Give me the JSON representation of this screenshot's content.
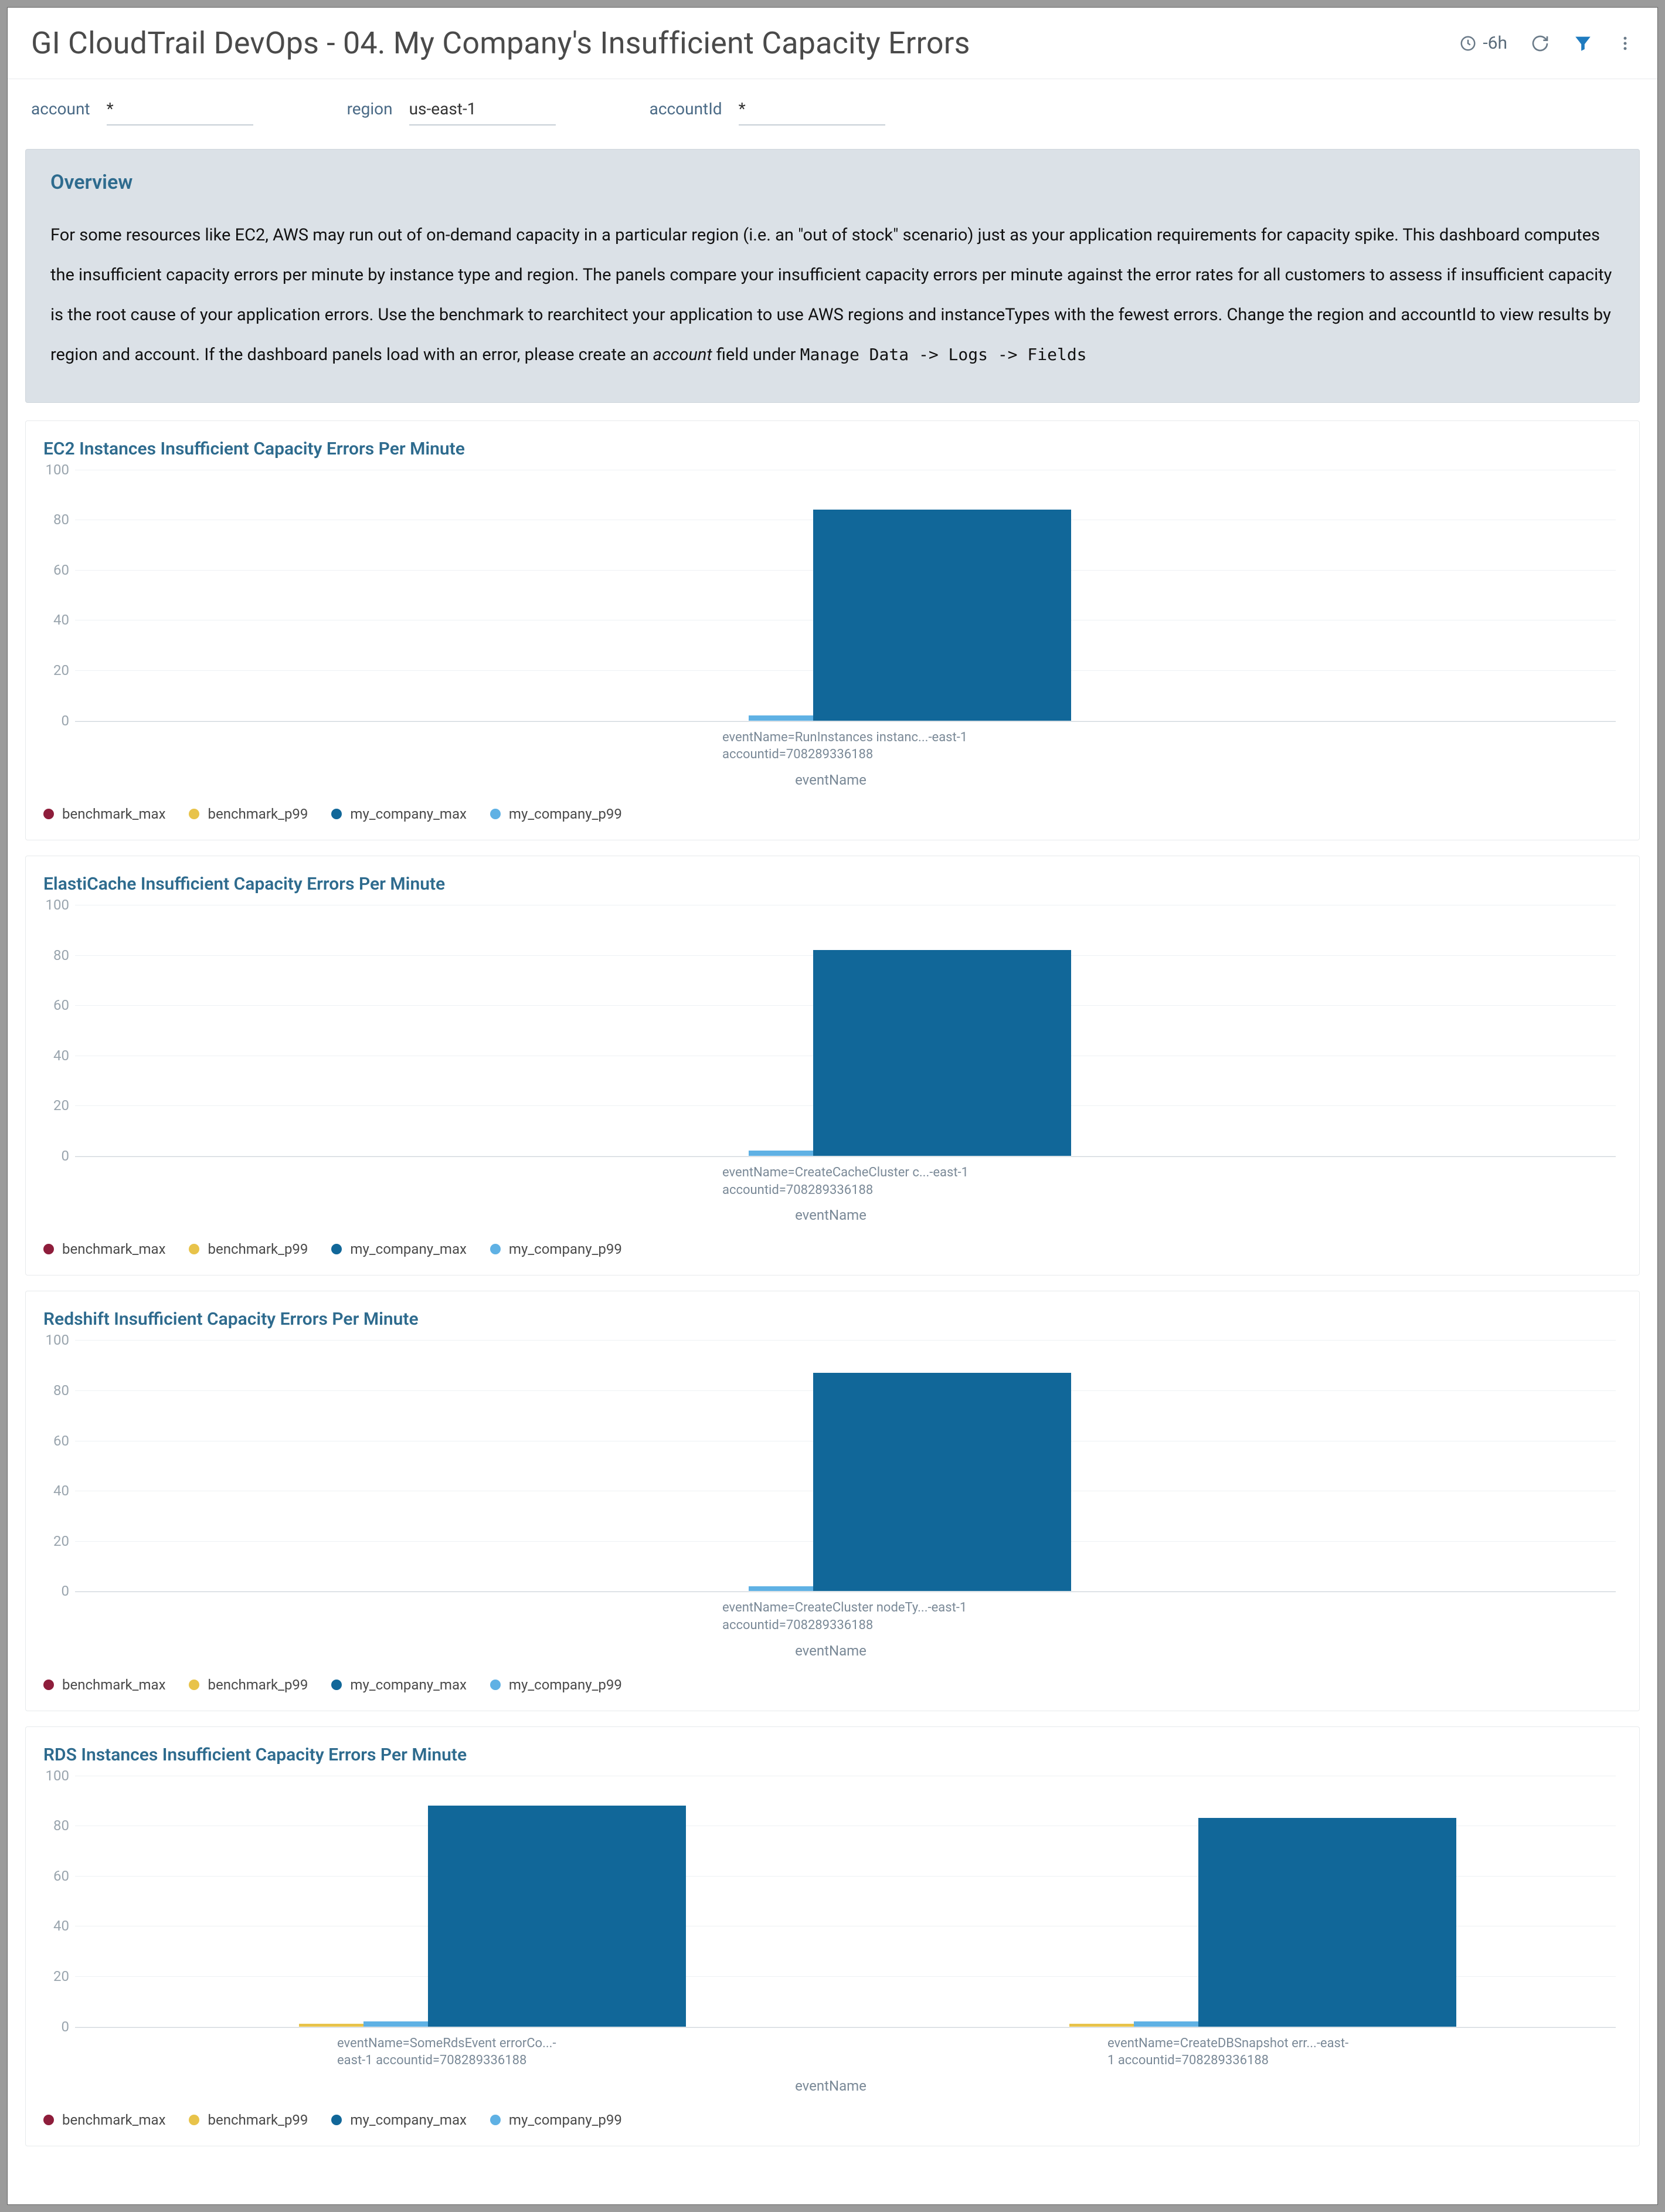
{
  "header": {
    "title": "GI CloudTrail DevOps - 04. My Company's Insufficient Capacity Errors",
    "time_range": "-6h"
  },
  "filters": {
    "account": {
      "label": "account",
      "value": "*"
    },
    "region": {
      "label": "region",
      "value": "us-east-1"
    },
    "accountId": {
      "label": "accountId",
      "value": "*"
    }
  },
  "overview": {
    "title": "Overview",
    "body_pre": "For some resources like EC2, AWS may run out of on-demand capacity in a particular region (i.e. an \"out of stock\" scenario) just as your application requirements for capacity spike. This dashboard computes the insufficient capacity errors per minute by instance type and region. The panels compare your insufficient capacity errors per minute against the error rates for all customers to assess if insufficient capacity is the root cause of your application errors. Use the benchmark to rearchitect your application to use AWS regions and instanceTypes with the fewest errors. Change the region and accountId to view results by region and account. If the dashboard panels load with an error, please create an ",
    "body_em": "account",
    "body_mid": " field under ",
    "body_code": " Manage Data -> Logs -> Fields"
  },
  "legend_series": [
    "benchmark_max",
    "benchmark_p99",
    "my_company_max",
    "my_company_p99"
  ],
  "chart_data": [
    {
      "id": "ec2",
      "title": "EC2 Instances Insufficient Capacity Errors Per Minute",
      "type": "bar",
      "xlabel": "eventName",
      "ylabel": "",
      "ylim": [
        0,
        100
      ],
      "yticks": [
        0,
        20,
        40,
        60,
        80,
        100
      ],
      "categories": [
        "eventName=RunInstances instanc...-east-1 accountid=708289336188"
      ],
      "series": [
        {
          "name": "benchmark_max",
          "values": [
            0
          ]
        },
        {
          "name": "benchmark_p99",
          "values": [
            0
          ]
        },
        {
          "name": "my_company_max",
          "values": [
            84
          ]
        },
        {
          "name": "my_company_p99",
          "values": [
            2
          ]
        }
      ]
    },
    {
      "id": "elasticache",
      "title": "ElastiCache Insufficient Capacity Errors Per Minute",
      "type": "bar",
      "xlabel": "eventName",
      "ylabel": "",
      "ylim": [
        0,
        100
      ],
      "yticks": [
        0,
        20,
        40,
        60,
        80,
        100
      ],
      "categories": [
        "eventName=CreateCacheCluster c...-east-1 accountid=708289336188"
      ],
      "series": [
        {
          "name": "benchmark_max",
          "values": [
            0
          ]
        },
        {
          "name": "benchmark_p99",
          "values": [
            0
          ]
        },
        {
          "name": "my_company_max",
          "values": [
            82
          ]
        },
        {
          "name": "my_company_p99",
          "values": [
            2
          ]
        }
      ]
    },
    {
      "id": "redshift",
      "title": "Redshift Insufficient Capacity Errors Per Minute",
      "type": "bar",
      "xlabel": "eventName",
      "ylabel": "",
      "ylim": [
        0,
        100
      ],
      "yticks": [
        0,
        20,
        40,
        60,
        80,
        100
      ],
      "categories": [
        "eventName=CreateCluster nodeTy...-east-1 accountid=708289336188"
      ],
      "series": [
        {
          "name": "benchmark_max",
          "values": [
            0
          ]
        },
        {
          "name": "benchmark_p99",
          "values": [
            0
          ]
        },
        {
          "name": "my_company_max",
          "values": [
            87
          ]
        },
        {
          "name": "my_company_p99",
          "values": [
            2
          ]
        }
      ]
    },
    {
      "id": "rds",
      "title": "RDS Instances Insufficient Capacity Errors Per Minute",
      "type": "bar",
      "xlabel": "eventName",
      "ylabel": "",
      "ylim": [
        0,
        100
      ],
      "yticks": [
        0,
        20,
        40,
        60,
        80,
        100
      ],
      "categories": [
        "eventName=SomeRdsEvent errorCo...-east-1 accountid=708289336188",
        "eventName=CreateDBSnapshot err...-east-1 accountid=708289336188"
      ],
      "series": [
        {
          "name": "benchmark_max",
          "values": [
            0,
            0
          ]
        },
        {
          "name": "benchmark_p99",
          "values": [
            1,
            1
          ]
        },
        {
          "name": "my_company_max",
          "values": [
            88,
            83
          ]
        },
        {
          "name": "my_company_p99",
          "values": [
            2,
            2
          ]
        }
      ]
    }
  ]
}
